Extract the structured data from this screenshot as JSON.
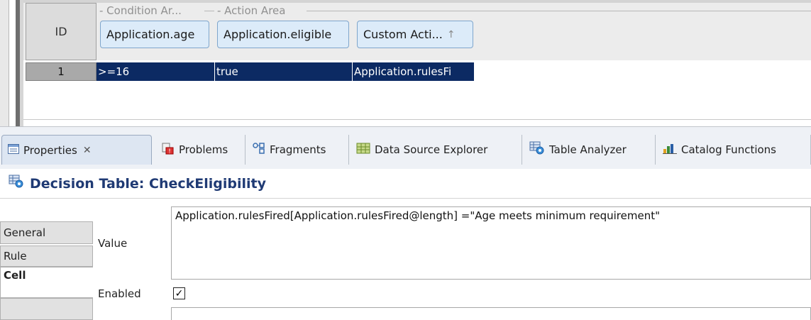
{
  "table": {
    "id_header": "ID",
    "groups": [
      {
        "label": "- Condition Ar..."
      },
      {
        "label": "- Action Area"
      }
    ],
    "columns": [
      {
        "label": "Application.age"
      },
      {
        "label": "Application.eligible"
      },
      {
        "label": "Custom Acti...",
        "sort_icon": "up-arrow-icon",
        "sort_glyph": "↑"
      }
    ],
    "rows": [
      {
        "id": "1",
        "cells": [
          ">=16",
          "true",
          "Application.rulesFi"
        ]
      }
    ]
  },
  "views_tabs": [
    {
      "label": "Properties",
      "icon": "properties-icon",
      "active": true,
      "close": "✕"
    },
    {
      "label": "Problems",
      "icon": "problems-icon"
    },
    {
      "label": "Fragments",
      "icon": "fragments-icon"
    },
    {
      "label": "Data Source Explorer",
      "icon": "data-source-explorer-icon"
    },
    {
      "label": "Table Analyzer",
      "icon": "table-analyzer-icon"
    },
    {
      "label": "Catalog Functions",
      "icon": "catalog-functions-icon"
    }
  ],
  "properties": {
    "title": "Decision Table: CheckEligibility",
    "side_tabs": [
      {
        "label": "General"
      },
      {
        "label": "Rule"
      },
      {
        "label": "Cell",
        "active": true
      }
    ],
    "value_label": "Value",
    "value_text": "Application.rulesFired[Application.rulesFired@length] =\"Age meets minimum requirement\"",
    "enabled_label": "Enabled",
    "enabled": true
  },
  "colors": {
    "selection": "#0c2a63",
    "header_fill": "#dcebf9",
    "title_text": "#1f3a74"
  }
}
